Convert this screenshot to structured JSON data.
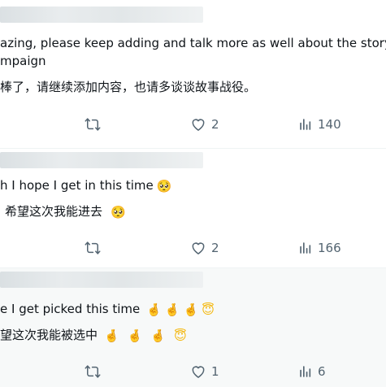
{
  "posts": [
    {
      "lines": [
        "azing, please keep adding and talk more as well about the story",
        "mpaign"
      ],
      "zh_line": "棒了，请继续添加内容，也请多谈谈故事战役。",
      "likes": "2",
      "views": "140"
    },
    {
      "lines": [
        "h I hope I get in this time"
      ],
      "zh_line": "希望这次我能进去",
      "likes": "2",
      "views": "166"
    },
    {
      "lines": [
        "e I get picked this time"
      ],
      "zh_line": "望这次我能被选中",
      "likes": "1",
      "views": "6"
    }
  ],
  "icons": {
    "retweet": "retweet-icon",
    "like": "heart-icon",
    "views": "views-bar-chart-icon",
    "pleading_face": "pleading-face-emoji",
    "crossed_fingers": "crossed-fingers-emoji",
    "halo_face": "smiling-face-with-halo-emoji"
  },
  "colors": {
    "text": "#0f1419",
    "muted": "#536471",
    "divider": "#eff3f4",
    "highlight_bg": "#f7f9f9"
  }
}
